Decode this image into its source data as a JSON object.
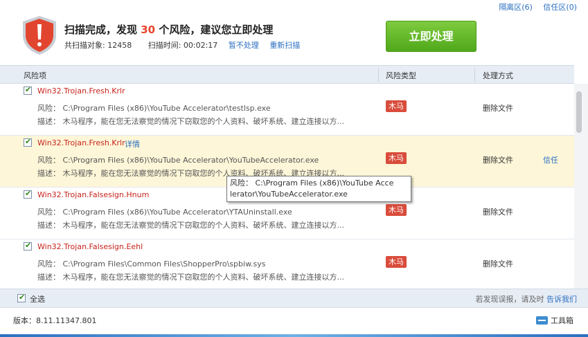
{
  "top_links": {
    "quarantine": "隔离区(6)",
    "trust_zone": "信任区(0)"
  },
  "header": {
    "title_prefix": "扫描完成，发现",
    "risk_count": "30",
    "title_suffix": "个风险，建议您立即处理",
    "scanned_label": "共扫描对象: 12458",
    "scan_time_label": "扫描时间: 00:02:17",
    "skip_link": "暂不处理",
    "rescan_link": "重新扫描",
    "primary_button": "立即处理"
  },
  "columns": {
    "item": "风险项",
    "type": "风险类型",
    "action": "处理方式"
  },
  "rows": [
    {
      "name": "Win32.Trojan.Fresh.Krlr",
      "detail": "",
      "risk": "风险： C:\\Program Files (x86)\\YouTube Accelerator\\testlsp.exe",
      "desc": "描述： 木马程序，能在您无法察觉的情况下窃取您的个人资料、破坏系统、建立连接以方...",
      "type": "木马",
      "action": "删除文件",
      "trust": ""
    },
    {
      "name": "Win32.Trojan.Fresh.Krlr",
      "detail": "详情",
      "risk": "风险： C:\\Program Files (x86)\\YouTube Accelerator\\YouTubeAccelerator.exe",
      "desc": "描述： 木马程序，能在您无法察觉的情况下窃取您的个人资料、破坏系统、建立连接以方...",
      "type": "木马",
      "action": "删除文件",
      "trust": "信任"
    },
    {
      "name": "Win32.Trojan.Falsesign.Hnum",
      "detail": "",
      "risk": "风险： C:\\Program Files (x86)\\YouTube Accelerator\\YTAUninstall.exe",
      "desc": "描述： 木马程序，能在您无法察觉的情况下窃取您的个人资料、破坏系统、建立连接以方...",
      "type": "木马",
      "action": "删除文件",
      "trust": ""
    },
    {
      "name": "Win32.Trojan.Falsesign.Eehl",
      "detail": "",
      "risk": "风险： C:\\Program Files\\Common Files\\ShopperPro\\spbiw.sys",
      "desc": "描述： 木马程序，能在您无法察觉的情况下窃取您的个人资料、破坏系统、建立连接以方...",
      "type": "木马",
      "action": "删除文件",
      "trust": ""
    }
  ],
  "tooltip": {
    "line1": "风险： C:\\Program Files (x86)\\YouTube Acce",
    "line2": "lerator\\YouTubeAccelerator.exe"
  },
  "footer": {
    "select_all": "全选",
    "feedback_prefix": "若发现误报，请及时",
    "feedback_link": "告诉我们"
  },
  "status": {
    "version": "版本：8.11.11347.801",
    "toolbox": "工具箱"
  },
  "colors": {
    "accent_green": "#5cb82a",
    "link_blue": "#2b6fc1",
    "danger_red": "#d94c3b",
    "highlight_row": "#fdf6d8"
  },
  "icons": {
    "shield": "shield-warning-icon",
    "checkbox": "checkbox-checked-icon",
    "toolbox": "toolbox-icon"
  }
}
